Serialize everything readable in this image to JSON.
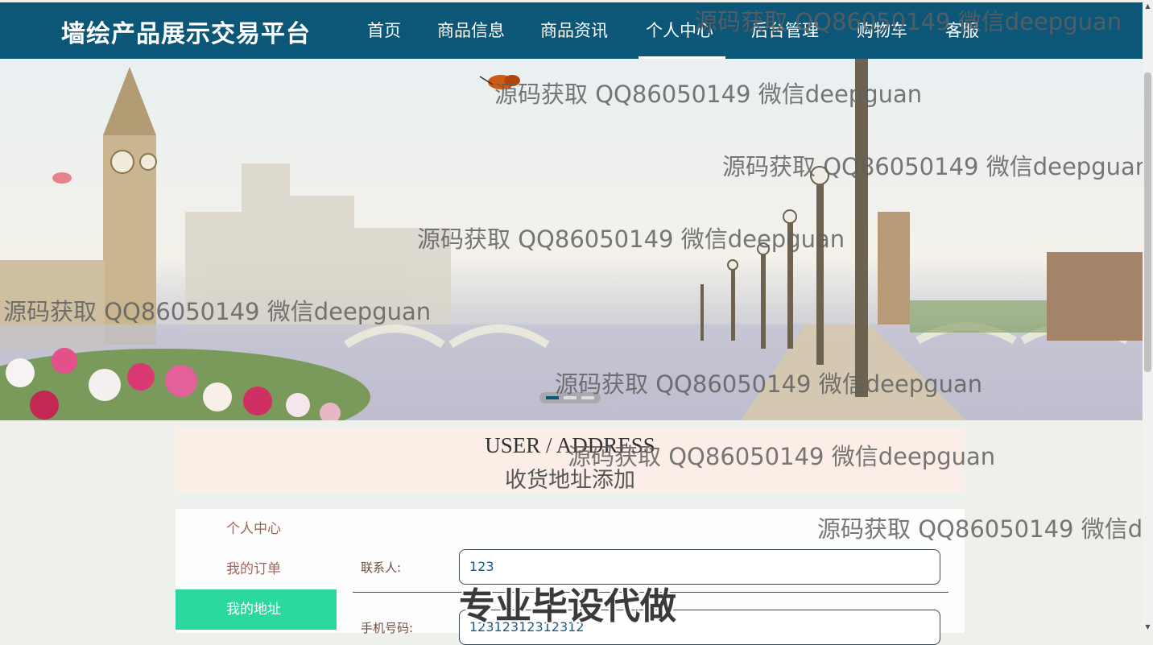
{
  "header": {
    "brand": "墙绘产品展示交易平台",
    "nav": [
      "首页",
      "商品信息",
      "商品资讯",
      "个人中心",
      "后台管理",
      "购物车",
      "客服"
    ],
    "active_nav": "个人中心"
  },
  "colors": {
    "nav_bg": "#0c5678",
    "accent_green": "#2bd9a0",
    "title_band_bg": "#fbeee6",
    "side_text": "#a0665a"
  },
  "banner": {
    "slide_count": 3,
    "active_slide": 1
  },
  "page_title": {
    "english": "USER / ADDRESS",
    "chinese": "收货地址添加"
  },
  "sidebar": {
    "items": [
      {
        "label": "个人中心"
      },
      {
        "label": "我的订单"
      },
      {
        "label": "我的地址"
      }
    ],
    "active_index": 2
  },
  "form": {
    "fields": [
      {
        "label": "联系人:",
        "value": "123"
      },
      {
        "label": "手机号码:",
        "value": "12312312312312"
      }
    ]
  },
  "watermark": {
    "text": "源码获取 QQ86050149 微信deepguan",
    "partial_text": "源码获取 QQ86050149 微信de",
    "stamp": "专业毕设代做"
  }
}
